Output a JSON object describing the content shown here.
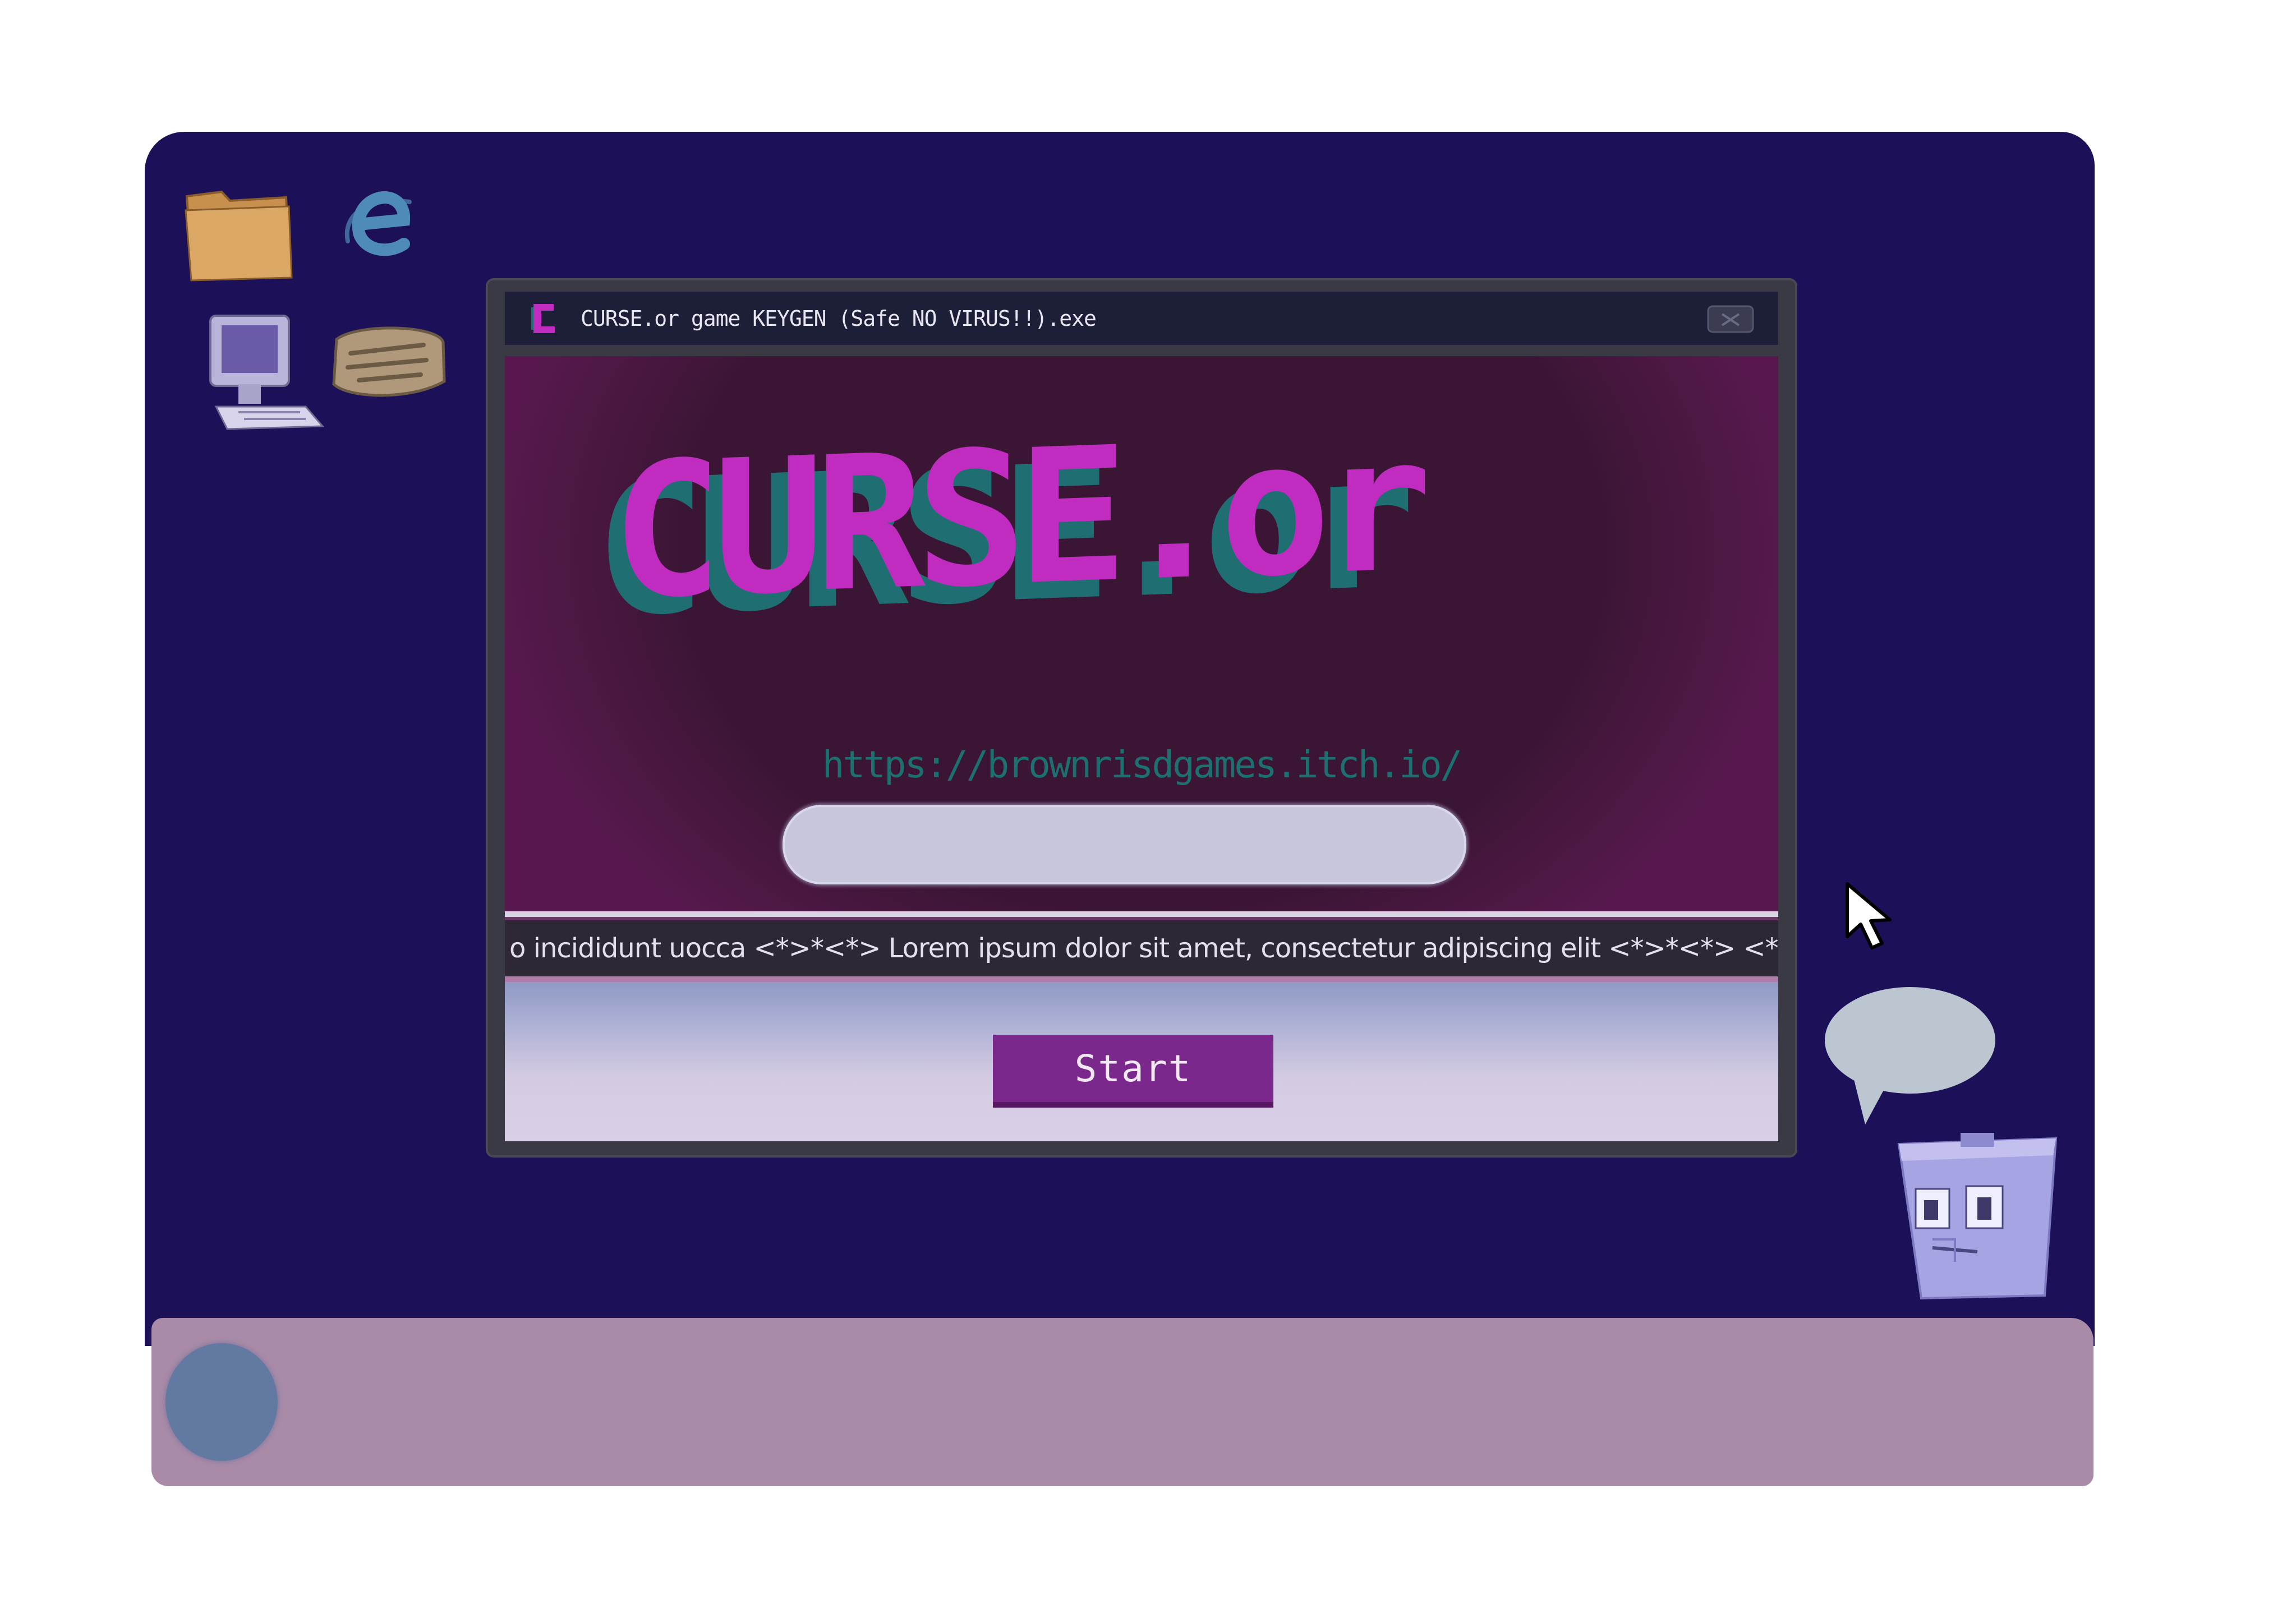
{
  "window": {
    "title": "CURSE.or game KEYGEN (Safe NO VIRUS!!).exe"
  },
  "hero": {
    "logo_text": "CURSE.or",
    "url": "https://brownrisdgames.itch.io/",
    "input_value": ""
  },
  "ticker": {
    "text": "o incididunt uocca <*>*<*> Lorem ipsum dolor sit amet, consectetur adipiscing elit  <*>*<*> <*>*<*>se"
  },
  "footer": {
    "start_label": "Start"
  },
  "desktop_icons": [
    "folder-icon",
    "internet-explorer-icon",
    "computer-icon",
    "scanner-icon",
    "mouse-cursor-icon",
    "speech-bubble-icon",
    "trash-can-icon"
  ],
  "colors": {
    "desktop_bg": "#1c1158",
    "taskbar": "#a98ba8",
    "logo_magenta": "#c02cc0",
    "logo_teal": "#1f6f72",
    "start_button": "#7a288c",
    "url_text": "#1d7070"
  }
}
